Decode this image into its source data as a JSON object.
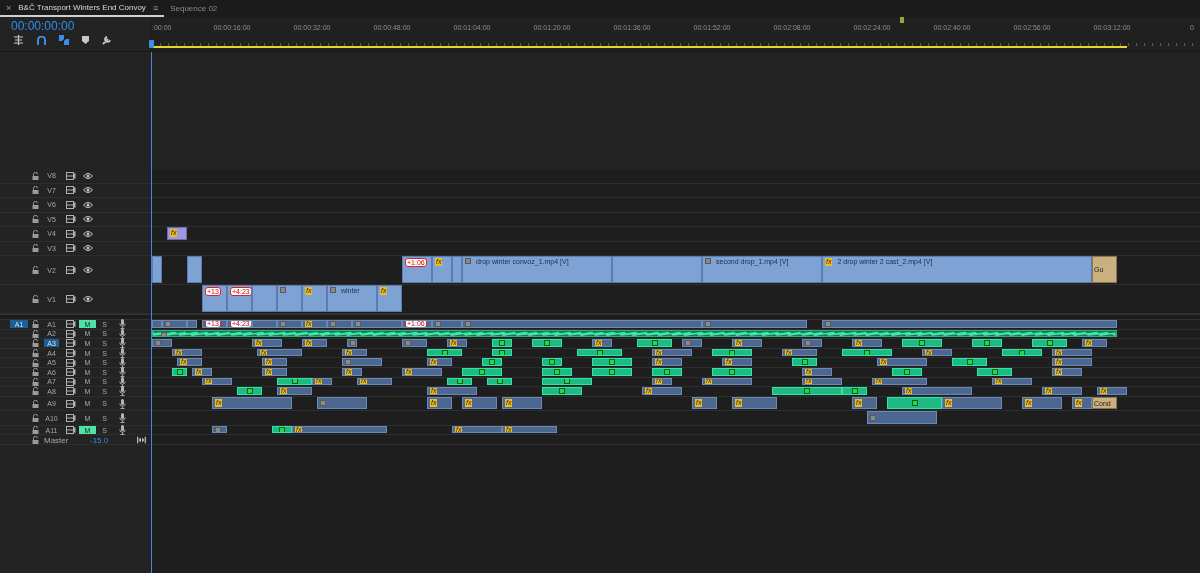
{
  "tabs": [
    {
      "label": "B&Č Transport Winters End Convoy",
      "selected": true,
      "close": "×",
      "menu": "≡"
    },
    {
      "label": "Sequence 02",
      "selected": false
    }
  ],
  "timecode": "00:00:00:00",
  "ruler": {
    "ticks": [
      ":00:00",
      "00:00:16:00",
      "00:00:32:00",
      "00:00:48:00",
      "00:01:04:00",
      "00:01:20:00",
      "00:01:36:00",
      "00:01:52:00",
      "00:02:08:00",
      "00:02:24:00",
      "00:02:40:00",
      "00:02:56:00",
      "00:03:12:00",
      "0"
    ]
  },
  "tracks": [
    {
      "name": "V8",
      "kind": "video",
      "expanded": false,
      "selected": false
    },
    {
      "name": "V7",
      "kind": "video",
      "expanded": false,
      "selected": false
    },
    {
      "name": "V6",
      "kind": "video",
      "expanded": false,
      "selected": false
    },
    {
      "name": "V5",
      "kind": "video",
      "expanded": false,
      "selected": false
    },
    {
      "name": "V4",
      "kind": "video",
      "expanded": false,
      "selected": false,
      "clips": [
        {
          "kind": "effect",
          "badge": "fx"
        }
      ]
    },
    {
      "name": "V3",
      "kind": "video",
      "expanded": false,
      "selected": false
    },
    {
      "name": "V2",
      "kind": "video",
      "expanded": true,
      "selected": false,
      "clips": [
        {
          "kind": "video"
        },
        {
          "kind": "video"
        },
        {
          "kind": "video",
          "marker": "+1:06"
        },
        {
          "kind": "video",
          "badge": "fx"
        },
        {
          "kind": "video"
        },
        {
          "kind": "video",
          "thumb": true,
          "label": "drop winter convoz_1.mp4 [V]"
        },
        {
          "kind": "video"
        },
        {
          "kind": "video",
          "thumb": true,
          "label": "second drop_1.mp4 [V]"
        },
        {
          "kind": "video",
          "badge": "fx",
          "label": "2 drop winter 2 cast_2.mp4 [V]"
        },
        {
          "kind": "title",
          "label": "Gu"
        }
      ]
    },
    {
      "name": "V1",
      "kind": "video",
      "expanded": true,
      "selected": false,
      "clips": [
        {
          "kind": "video",
          "marker": "+13"
        },
        {
          "kind": "video",
          "marker": "+4:23"
        },
        {
          "kind": "video"
        },
        {
          "kind": "video",
          "thumb": true
        },
        {
          "kind": "video",
          "badge": "fx"
        },
        {
          "kind": "video",
          "thumb": true,
          "label": "winter"
        },
        {
          "kind": "video",
          "badge": "fx"
        }
      ]
    },
    {
      "name": "A1",
      "kind": "audio",
      "expanded": false,
      "selected": false,
      "source": {
        "label": "A1",
        "selected": true
      },
      "mute": {
        "label": "M",
        "on": true
      },
      "solo": {
        "label": "S",
        "on": false
      },
      "clips": [
        {
          "kind": "audio"
        },
        {
          "kind": "audio",
          "thumb": true
        },
        {
          "kind": "audio"
        },
        {
          "kind": "audio",
          "marker": "+13"
        },
        {
          "kind": "audio",
          "marker": "+4:23"
        },
        {
          "kind": "audio"
        },
        {
          "kind": "audio",
          "thumb": true
        },
        {
          "kind": "audio",
          "badge": "fx"
        },
        {
          "kind": "audio",
          "thumb": true
        },
        {
          "kind": "audio",
          "thumb": true
        },
        {
          "kind": "audio",
          "marker": "+1:06"
        },
        {
          "kind": "audio",
          "thumb": true
        },
        {
          "kind": "audio",
          "thumb": true
        },
        {
          "kind": "audio",
          "thumb": true
        },
        {
          "kind": "audio",
          "thumb": true
        }
      ]
    },
    {
      "name": "A2",
      "kind": "audio",
      "expanded": false,
      "selected": false,
      "mute": {
        "label": "M",
        "on": false
      },
      "solo": {
        "label": "S",
        "on": false
      },
      "clips": [
        {
          "kind": "wave",
          "thumb": true
        }
      ]
    },
    {
      "name": "A3",
      "kind": "audio",
      "expanded": false,
      "selected": true,
      "mute": {
        "label": "M",
        "on": false
      },
      "solo": {
        "label": "S",
        "on": false
      },
      "clips": [
        {
          "kind": "audio",
          "thumb": true
        },
        {
          "kind": "audio",
          "badge": "fx"
        },
        {
          "kind": "audio",
          "badge": "fx"
        },
        {
          "kind": "audio",
          "thumb": true
        },
        {
          "kind": "audio",
          "thumb": true
        },
        {
          "kind": "audio",
          "badge": "fx"
        },
        {
          "kind": "green"
        },
        {
          "kind": "green"
        },
        {
          "kind": "audio",
          "badge": "fx"
        },
        {
          "kind": "green"
        },
        {
          "kind": "audio",
          "thumb": true
        },
        {
          "kind": "audio",
          "badge": "fx"
        },
        {
          "kind": "audio",
          "thumb": true
        },
        {
          "kind": "audio",
          "badge": "fx"
        },
        {
          "kind": "green"
        },
        {
          "kind": "green"
        },
        {
          "kind": "green"
        },
        {
          "kind": "audio",
          "badge": "fx"
        }
      ]
    },
    {
      "name": "A4",
      "kind": "audio",
      "expanded": false,
      "selected": false,
      "mute": {
        "label": "M",
        "on": false
      },
      "solo": {
        "label": "S",
        "on": false
      },
      "clips": [
        {
          "kind": "audio",
          "badge": "fx"
        },
        {
          "kind": "audio",
          "badge": "fx"
        },
        {
          "kind": "audio",
          "badge": "fx"
        },
        {
          "kind": "green"
        },
        {
          "kind": "green"
        },
        {
          "kind": "green"
        },
        {
          "kind": "audio",
          "badge": "fx"
        },
        {
          "kind": "green"
        },
        {
          "kind": "audio",
          "badge": "fx"
        },
        {
          "kind": "green"
        },
        {
          "kind": "audio",
          "badge": "fx"
        },
        {
          "kind": "green"
        },
        {
          "kind": "audio",
          "badge": "fx"
        }
      ]
    },
    {
      "name": "A5",
      "kind": "audio",
      "expanded": false,
      "selected": false,
      "mute": {
        "label": "M",
        "on": false
      },
      "solo": {
        "label": "S",
        "on": false
      },
      "clips": [
        {
          "kind": "audio",
          "badge": "fx"
        },
        {
          "kind": "audio",
          "badge": "fx"
        },
        {
          "kind": "audio",
          "thumb": true
        },
        {
          "kind": "audio",
          "badge": "fx"
        },
        {
          "kind": "green"
        },
        {
          "kind": "green"
        },
        {
          "kind": "green"
        },
        {
          "kind": "audio",
          "badge": "fx"
        },
        {
          "kind": "audio",
          "badge": "fx"
        },
        {
          "kind": "green"
        },
        {
          "kind": "audio",
          "badge": "fx"
        },
        {
          "kind": "green"
        },
        {
          "kind": "audio",
          "badge": "fx"
        }
      ]
    },
    {
      "name": "A6",
      "kind": "audio",
      "expanded": false,
      "selected": false,
      "mute": {
        "label": "M",
        "on": false
      },
      "solo": {
        "label": "S",
        "on": false
      },
      "clips": [
        {
          "kind": "green"
        },
        {
          "kind": "audio",
          "badge": "fx"
        },
        {
          "kind": "audio",
          "badge": "fx"
        },
        {
          "kind": "audio",
          "badge": "fx"
        },
        {
          "kind": "audio",
          "badge": "fx"
        },
        {
          "kind": "green"
        },
        {
          "kind": "green"
        },
        {
          "kind": "green"
        },
        {
          "kind": "green"
        },
        {
          "kind": "green"
        },
        {
          "kind": "audio",
          "badge": "fx"
        },
        {
          "kind": "green"
        },
        {
          "kind": "green"
        },
        {
          "kind": "audio",
          "badge": "fx"
        }
      ]
    },
    {
      "name": "A7",
      "kind": "audio",
      "expanded": false,
      "selected": false,
      "mute": {
        "label": "M",
        "on": false
      },
      "solo": {
        "label": "S",
        "on": false
      },
      "clips": [
        {
          "kind": "audio",
          "badge": "fx"
        },
        {
          "kind": "green"
        },
        {
          "kind": "audio",
          "badge": "fx"
        },
        {
          "kind": "audio",
          "badge": "fx"
        },
        {
          "kind": "green"
        },
        {
          "kind": "green"
        },
        {
          "kind": "green"
        },
        {
          "kind": "audio",
          "badge": "fx"
        },
        {
          "kind": "audio",
          "badge": "fx"
        },
        {
          "kind": "audio",
          "badge": "fx"
        },
        {
          "kind": "audio",
          "badge": "fx"
        },
        {
          "kind": "audio",
          "badge": "fx"
        }
      ]
    },
    {
      "name": "A8",
      "kind": "audio",
      "expanded": false,
      "selected": false,
      "mute": {
        "label": "M",
        "on": false
      },
      "solo": {
        "label": "S",
        "on": false
      },
      "clips": [
        {
          "kind": "green"
        },
        {
          "kind": "audio",
          "badge": "fx"
        },
        {
          "kind": "audio",
          "badge": "fx"
        },
        {
          "kind": "green"
        },
        {
          "kind": "audio",
          "badge": "fx"
        },
        {
          "kind": "green"
        },
        {
          "kind": "green"
        },
        {
          "kind": "audio",
          "badge": "fx"
        },
        {
          "kind": "audio",
          "badge": "fx"
        },
        {
          "kind": "audio",
          "badge": "fx"
        }
      ]
    },
    {
      "name": "A9",
      "kind": "audio",
      "expanded": true,
      "selected": false,
      "mute": {
        "label": "M",
        "on": false
      },
      "solo": {
        "label": "S",
        "on": false
      },
      "clips": [
        {
          "kind": "audio",
          "badge": "fx"
        },
        {
          "kind": "audio",
          "thumb": true
        },
        {
          "kind": "audio",
          "badge": "fx"
        },
        {
          "kind": "audio",
          "badge": "fx"
        },
        {
          "kind": "audio",
          "badge": "fx"
        },
        {
          "kind": "audio",
          "badge": "fx"
        },
        {
          "kind": "audio",
          "badge": "fx"
        },
        {
          "kind": "audio",
          "badge": "fx"
        },
        {
          "kind": "green"
        },
        {
          "kind": "audio",
          "badge": "fx"
        },
        {
          "kind": "audio",
          "badge": "fx"
        },
        {
          "kind": "audio",
          "badge": "fx"
        },
        {
          "kind": "title",
          "label": "Cond"
        }
      ]
    },
    {
      "name": "A10",
      "kind": "audio",
      "expanded": true,
      "selected": false,
      "mute": {
        "label": "M",
        "on": false
      },
      "solo": {
        "label": "S",
        "on": false
      },
      "clips": [
        {
          "kind": "audio",
          "thumb": true
        }
      ]
    },
    {
      "name": "A11",
      "kind": "audio",
      "expanded": false,
      "selected": false,
      "mute": {
        "label": "M",
        "on": true
      },
      "solo": {
        "label": "S",
        "on": false
      },
      "clips": [
        {
          "kind": "audio",
          "thumb": true
        },
        {
          "kind": "green"
        },
        {
          "kind": "audio",
          "badge": "fx"
        },
        {
          "kind": "audio",
          "badge": "fx"
        },
        {
          "kind": "audio",
          "badge": "fx"
        }
      ]
    },
    {
      "name": "Master",
      "kind": "master",
      "volume": "-15.0"
    }
  ]
}
